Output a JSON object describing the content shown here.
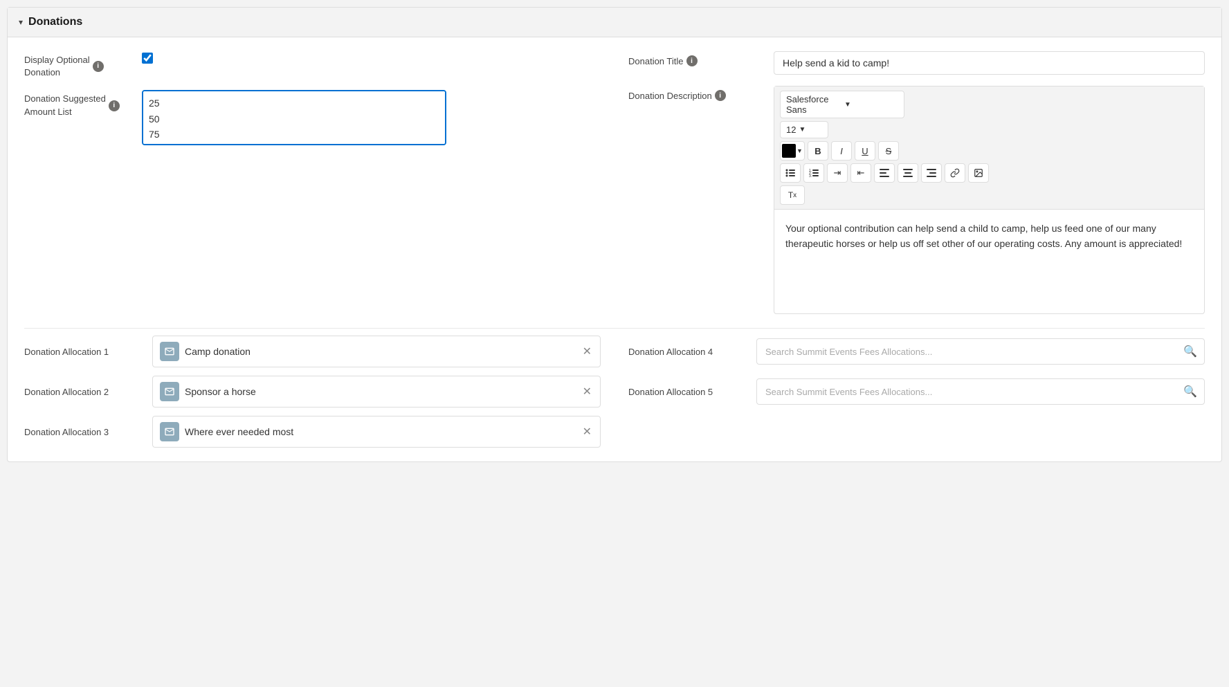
{
  "panel": {
    "title": "Donations",
    "chevron": "▾"
  },
  "left": {
    "display_optional_label": "Display Optional\nDonation",
    "display_optional_checked": true,
    "suggested_amount_label": "Donation Suggested\nAmount List",
    "suggested_amounts": [
      "25",
      "50",
      "75"
    ]
  },
  "right": {
    "donation_title_label": "Donation Title",
    "donation_title_value": "Help send a kid to camp!",
    "donation_description_label": "Donation Description",
    "font_family": "Salesforce Sans",
    "font_size": "12",
    "description_text": "Your optional contribution can help send a child to camp, help us feed one of our many therapeutic horses or help us off set other of our operating costs. Any amount is appreciated!"
  },
  "allocations": {
    "alloc1_label": "Donation Allocation 1",
    "alloc1_value": "Camp donation",
    "alloc2_label": "Donation Allocation 2",
    "alloc2_value": "Sponsor a horse",
    "alloc3_label": "Donation Allocation 3",
    "alloc3_value": "Where ever needed most",
    "alloc4_label": "Donation Allocation 4",
    "alloc4_placeholder": "Search Summit Events Fees Allocations...",
    "alloc5_label": "Donation Allocation 5",
    "alloc5_placeholder": "Search Summit Events Fees Allocations..."
  },
  "toolbar": {
    "bold_label": "B",
    "italic_label": "I",
    "underline_label": "U",
    "strikethrough_label": "S",
    "clear_label": "Tx"
  }
}
